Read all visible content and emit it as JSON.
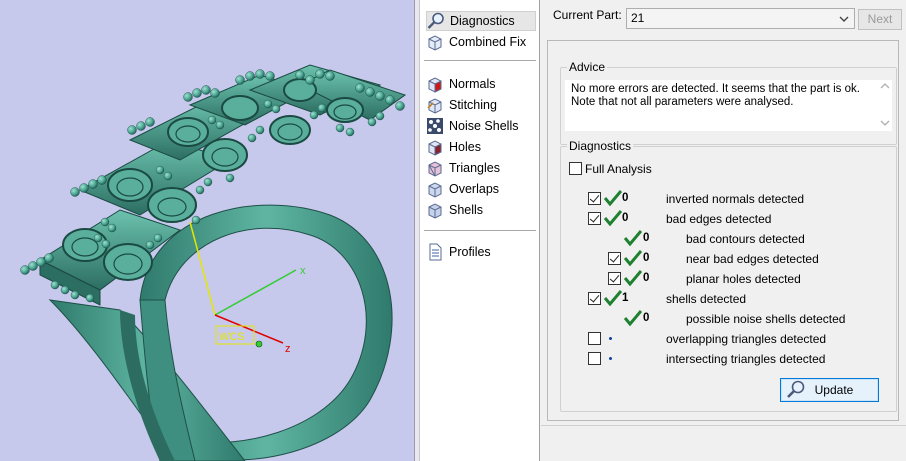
{
  "viewport": {
    "axes": {
      "x_label": "x",
      "z_label": "z",
      "wcs_label": "WCS"
    },
    "colors": {
      "background": "#c6c8ec",
      "model": "#4a9c8c",
      "x_axis": "#33cc33",
      "y_axis": "#e6e600",
      "z_axis": "#e00000"
    }
  },
  "nav": {
    "items_top": [
      {
        "label": "Diagnostics",
        "icon": "magnifier-icon",
        "selected": true
      },
      {
        "label": "Combined Fix",
        "icon": "cube-icon"
      }
    ],
    "items_mid": [
      {
        "label": "Normals",
        "icon": "normals-cube-icon"
      },
      {
        "label": "Stitching",
        "icon": "stitching-cube-icon"
      },
      {
        "label": "Noise Shells",
        "icon": "noise-shells-icon"
      },
      {
        "label": "Holes",
        "icon": "holes-cube-icon"
      },
      {
        "label": "Triangles",
        "icon": "triangles-cube-icon"
      },
      {
        "label": "Overlaps",
        "icon": "overlaps-cube-icon"
      },
      {
        "label": "Shells",
        "icon": "shells-cube-icon"
      }
    ],
    "items_bottom": [
      {
        "label": "Profiles",
        "icon": "document-icon"
      }
    ]
  },
  "part": {
    "label": "Current Part:",
    "value": "21",
    "next_label": "Next"
  },
  "advice": {
    "title": "Advice",
    "line1": "No more errors are detected. It seems that the part is ok.",
    "line2": "Note that not all parameters were analysed."
  },
  "diagnostics": {
    "title": "Diagnostics",
    "full_analysis_label": "Full Analysis",
    "full_analysis_checked": false,
    "rows": [
      {
        "checked": true,
        "status": "ok",
        "count": "0",
        "label": "inverted normals detected"
      },
      {
        "checked": true,
        "status": "ok",
        "count": "0",
        "label": "bad edges detected"
      },
      {
        "checked": null,
        "status": "ok",
        "count": "0",
        "label": "bad contours detected"
      },
      {
        "checked": true,
        "status": "ok",
        "count": "0",
        "label": "near bad edges detected"
      },
      {
        "checked": true,
        "status": "ok",
        "count": "0",
        "label": "planar holes detected"
      },
      {
        "checked": true,
        "status": "ok",
        "count": "1",
        "label": "shells detected"
      },
      {
        "checked": null,
        "status": "ok",
        "count": "0",
        "label": "possible noise shells detected"
      },
      {
        "checked": false,
        "status": "pending",
        "count": "",
        "label": "overlapping triangles detected"
      },
      {
        "checked": false,
        "status": "pending",
        "count": "",
        "label": "intersecting triangles detected"
      }
    ],
    "update_label": "Update"
  }
}
